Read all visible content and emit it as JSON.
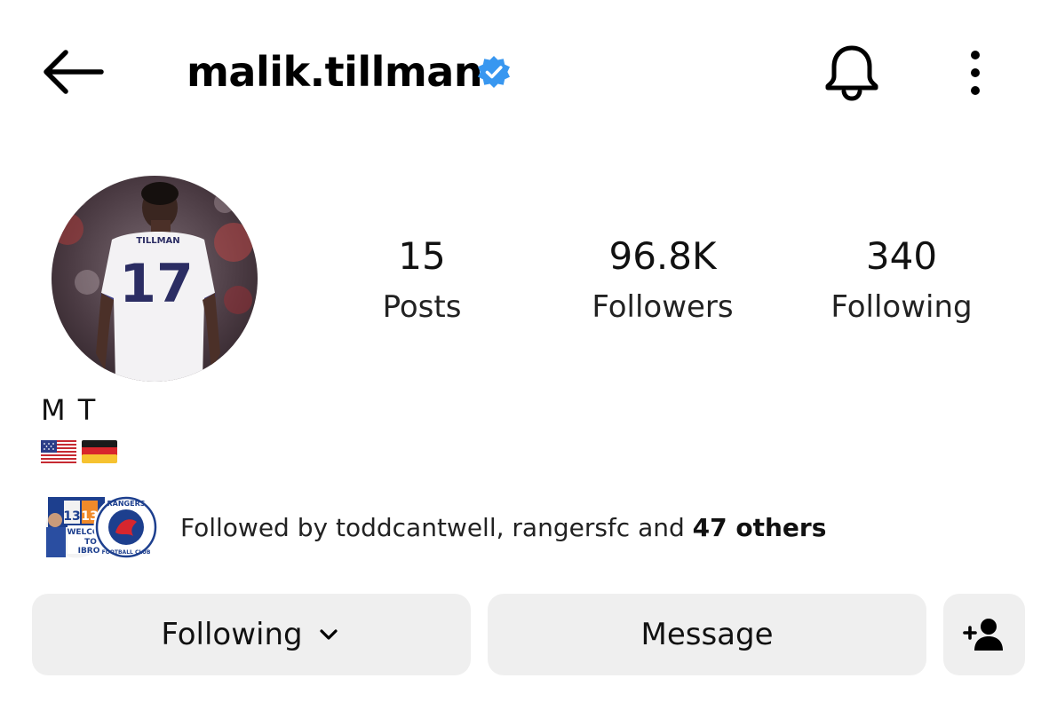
{
  "header": {
    "username": "malik.tillman",
    "back_icon": "arrow-left-icon",
    "verified_icon": "verified-badge-icon",
    "bell_icon": "bell-icon",
    "more_icon": "more-vertical-icon"
  },
  "profile": {
    "avatar": "profile-photo",
    "jersey_name": "TILLMAN",
    "jersey_number": "17",
    "full_name": "M T",
    "flags": [
      "us-flag-icon",
      "germany-flag-icon"
    ]
  },
  "stats": {
    "posts": {
      "value": "15",
      "label": "Posts"
    },
    "followers": {
      "value": "96.8K",
      "label": "Followers"
    },
    "following": {
      "value": "340",
      "label": "Following"
    }
  },
  "followed_by": {
    "prefix": "Followed by ",
    "names": "toddcantwell, rangersfc",
    "connector": " and ",
    "others": "47 others",
    "avatar_1_lines": [
      "13",
      "13",
      "WELCOM",
      "TO",
      "IBRO"
    ],
    "avatar_2_lines": [
      "RANGERS",
      "FOOTBALL CLUB"
    ]
  },
  "actions": {
    "following_label": "Following",
    "following_icon": "chevron-down-icon",
    "message_label": "Message",
    "add_user_icon": "add-person-icon"
  },
  "colors": {
    "accent": "#3897f0",
    "button_bg": "#efefef",
    "text": "#000000"
  }
}
